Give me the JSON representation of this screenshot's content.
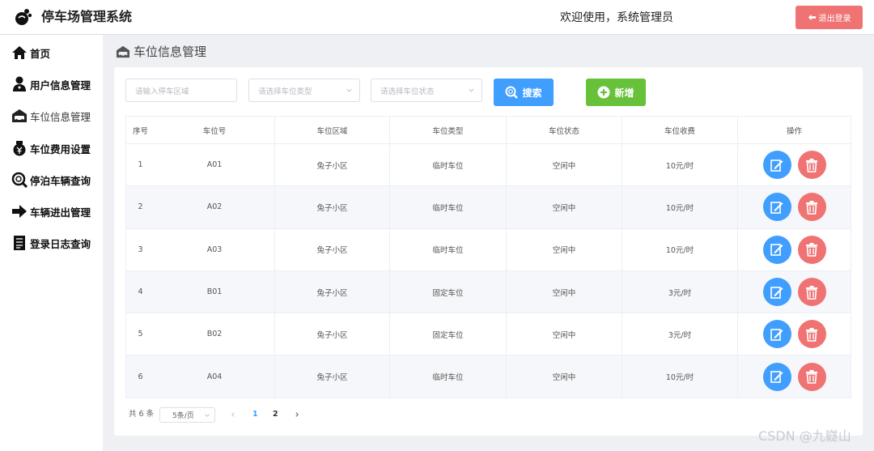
{
  "app": {
    "title": "停车场管理系统"
  },
  "header": {
    "welcome": "欢迎使用，系统管理员",
    "logout_label": "退出登录"
  },
  "sidebar": {
    "items": [
      {
        "label": "首页",
        "icon": "home-icon"
      },
      {
        "label": "用户信息管理",
        "icon": "user-icon"
      },
      {
        "label": "车位信息管理",
        "icon": "garage-icon"
      },
      {
        "label": "车位费用设置",
        "icon": "fee-icon"
      },
      {
        "label": "停泊车辆查询",
        "icon": "search-icon"
      },
      {
        "label": "车辆进出管理",
        "icon": "arrow-right-icon"
      },
      {
        "label": "登录日志查询",
        "icon": "document-icon"
      }
    ]
  },
  "main": {
    "heading": "车位信息管理",
    "filters": {
      "area_placeholder": "请输入停车区域",
      "type_placeholder": "请选择车位类型",
      "status_placeholder": "请选择车位状态"
    },
    "search_label": "搜索",
    "add_label": "新增"
  },
  "table": {
    "headers": [
      "序号",
      "车位号",
      "车位区域",
      "车位类型",
      "车位状态",
      "车位收费",
      "操作"
    ],
    "rows": [
      [
        "1",
        "A01",
        "兔子小区",
        "临时车位",
        "空闲中",
        "10元/时"
      ],
      [
        "2",
        "A02",
        "兔子小区",
        "临时车位",
        "空闲中",
        "10元/时"
      ],
      [
        "3",
        "A03",
        "兔子小区",
        "临时车位",
        "空闲中",
        "10元/时"
      ],
      [
        "4",
        "B01",
        "兔子小区",
        "固定车位",
        "空闲中",
        "3元/时"
      ],
      [
        "5",
        "B02",
        "兔子小区",
        "固定车位",
        "空闲中",
        "3元/时"
      ],
      [
        "6",
        "A04",
        "兔子小区",
        "临时车位",
        "空闲中",
        "10元/时"
      ]
    ]
  },
  "pagination": {
    "total": "共 6 条",
    "page_size": "5条/页",
    "pages": [
      "1",
      "2"
    ],
    "current_page": "1",
    "prev_icon": "chevron-left-icon",
    "next_icon": "chevron-right-icon"
  },
  "watermark": "CSDN @九嶷山",
  "colors": {
    "primary": "#409eff",
    "success": "#67c23a",
    "danger": "#f07373"
  }
}
